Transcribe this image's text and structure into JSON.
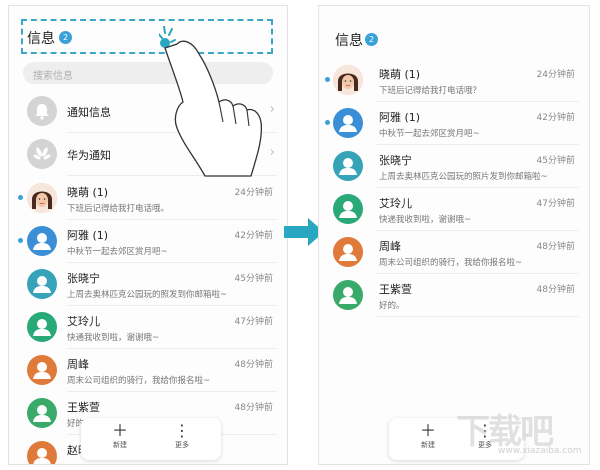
{
  "left": {
    "title": "信息",
    "badge": "2",
    "search_placeholder": "搜索信息",
    "system_rows": [
      {
        "name": "通知信息",
        "icon": "bell-icon"
      },
      {
        "name": "华为通知",
        "icon": "huawei-icon"
      }
    ],
    "conversations": [
      {
        "name": "晓萌 (1)",
        "preview": "下班后记得给我打电话哦。",
        "time": "24分钟前",
        "unread": true,
        "avatar": "photo",
        "color": "#f2c9a8"
      },
      {
        "name": "阿雅 (1)",
        "preview": "中秋节一起去郊区赏月吧~",
        "time": "42分钟前",
        "unread": true,
        "avatar": "person",
        "color": "#3b8fd6"
      },
      {
        "name": "张晓宁",
        "preview": "上周去奥林匹克公园玩的照发到你邮箱啦~",
        "time": "45分钟前",
        "unread": false,
        "avatar": "person",
        "color": "#36a3b8"
      },
      {
        "name": "艾玲儿",
        "preview": "快通我收到啦，谢谢哦~",
        "time": "47分钟前",
        "unread": false,
        "avatar": "person",
        "color": "#2aa978"
      },
      {
        "name": "周峰",
        "preview": "周末公司组织的骑行，我给你报名啦~",
        "time": "48分钟前",
        "unread": false,
        "avatar": "person",
        "color": "#e07a3a"
      },
      {
        "name": "王紫萱",
        "preview": "好的。",
        "time": "48分钟前",
        "unread": false,
        "avatar": "person",
        "color": "#3aaa6a"
      },
      {
        "name": "赵晓",
        "preview": "",
        "time": "",
        "unread": false,
        "avatar": "person",
        "color": "#e07a3a"
      }
    ],
    "bottom": {
      "new_label": "新建",
      "more_label": "更多"
    }
  },
  "right": {
    "title": "信息",
    "badge": "2",
    "conversations": [
      {
        "name": "晓萌 (1)",
        "preview": "下班后记得给我打电话哦？",
        "time": "24分钟前",
        "unread": true,
        "avatar": "photo",
        "color": "#f2c9a8"
      },
      {
        "name": "阿雅 (1)",
        "preview": "中秋节一起去郊区赏月吧~",
        "time": "42分钟前",
        "unread": true,
        "avatar": "person",
        "color": "#3b8fd6"
      },
      {
        "name": "张晓宁",
        "preview": "上周去奥林匹克公园玩的照片发到你邮箱啦~",
        "time": "45分钟前",
        "unread": false,
        "avatar": "person",
        "color": "#36a3b8"
      },
      {
        "name": "艾玲儿",
        "preview": "快递我收到啦，谢谢哦~",
        "time": "47分钟前",
        "unread": false,
        "avatar": "person",
        "color": "#2aa978"
      },
      {
        "name": "周峰",
        "preview": "周末公司组织的骑行，我给你报名啦~",
        "time": "48分钟前",
        "unread": false,
        "avatar": "person",
        "color": "#e07a3a"
      },
      {
        "name": "王紫萱",
        "preview": "好的。",
        "time": "48分钟前",
        "unread": false,
        "avatar": "person",
        "color": "#3aaa6a"
      }
    ],
    "bottom": {
      "new_label": "新建",
      "more_label": "更多"
    }
  },
  "watermark": {
    "text": "下载吧",
    "url": "www.xiazaiba.com"
  },
  "colors": {
    "accent": "#3aa0d8",
    "arrow": "#2aa7c0"
  }
}
